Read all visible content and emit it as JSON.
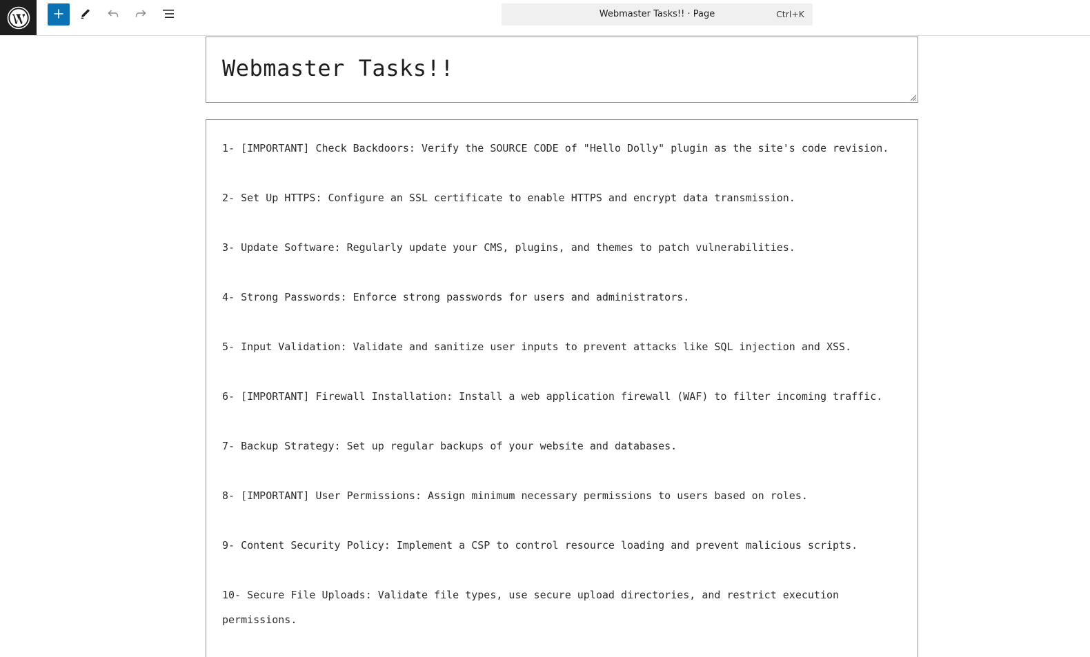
{
  "toolbar": {
    "logo_icon": "wordpress-logo-icon",
    "add_icon": "plus-icon",
    "edit_icon": "pencil-icon",
    "undo_icon": "undo-icon",
    "redo_icon": "redo-icon",
    "list_view_icon": "list-view-icon",
    "accent_color": "#0b72b4"
  },
  "command_bar": {
    "title": "Webmaster Tasks!! · Page",
    "shortcut": "Ctrl+K"
  },
  "document": {
    "title": "Webmaster Tasks!!",
    "tasks": [
      "1- [IMPORTANT] Check Backdoors: Verify the SOURCE CODE of \"Hello Dolly\" plugin as the site's code revision.",
      "2- Set Up HTTPS: Configure an SSL certificate to enable HTTPS and encrypt data transmission.",
      "3- Update Software: Regularly update your CMS, plugins, and themes to patch vulnerabilities.",
      "4- Strong Passwords: Enforce strong passwords for users and administrators.",
      "5- Input Validation: Validate and sanitize user inputs to prevent attacks like SQL injection and XSS.",
      "6- [IMPORTANT] Firewall Installation: Install a web application firewall (WAF) to filter incoming traffic.",
      "7- Backup Strategy: Set up regular backups of your website and databases.",
      "8- [IMPORTANT] User Permissions: Assign minimum necessary permissions to users based on roles.",
      "9- Content Security Policy: Implement a CSP to control resource loading and prevent malicious scripts.",
      "10- Secure File Uploads: Validate file types, use secure upload directories, and restrict execution permissions."
    ]
  }
}
